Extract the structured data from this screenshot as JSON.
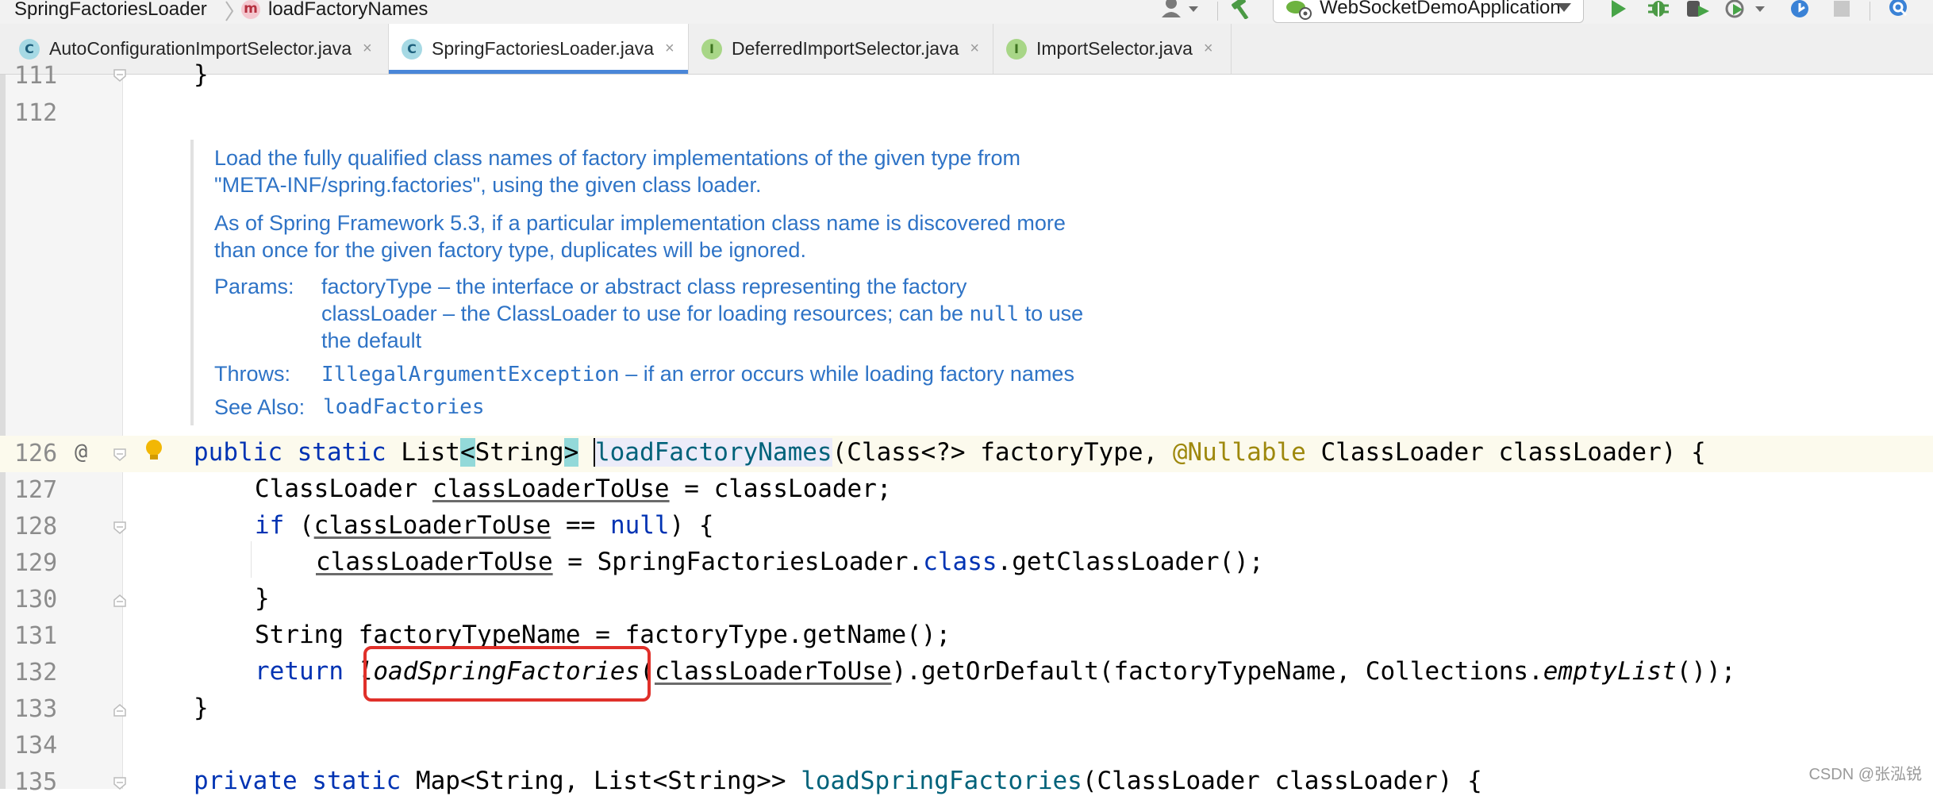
{
  "navbar": {
    "breadcrumb_class": "SpringFactoriesLoader",
    "breadcrumb_method_icon": "m",
    "breadcrumb_method": "loadFactoryNames",
    "run_config": "WebSocketDemoApplication"
  },
  "tabs": [
    {
      "label": "AutoConfigurationImportSelector.java",
      "icon": "C",
      "close": "×"
    },
    {
      "label": "SpringFactoriesLoader.java",
      "icon": "C",
      "close": "×"
    },
    {
      "label": "DeferredImportSelector.java",
      "icon": "I",
      "close": "×"
    },
    {
      "label": "ImportSelector.java",
      "icon": "I",
      "close": "×"
    }
  ],
  "gutter": {
    "line_numbers": [
      "111",
      "112",
      "126",
      "127",
      "128",
      "129",
      "130",
      "131",
      "132",
      "133",
      "134",
      "135"
    ],
    "at_marker": "@"
  },
  "doc": {
    "p1_line1": "Load the fully qualified class names of factory implementations of the given type from",
    "p1_line2": "\"META-INF/spring.factories\", using the given class loader.",
    "p2_line1": "As of Spring Framework 5.3, if a particular implementation class name is discovered more",
    "p2_line2": "than once for the given factory type, duplicates will be ignored.",
    "params_label": "Params:",
    "param1": "factoryType – the interface or abstract class representing the factory",
    "param2_a": "classLoader – the ClassLoader to use for loading resources; can be ",
    "param2_null": "null",
    "param2_b": " to use",
    "param2_line2": "the default",
    "throws_label": "Throws:",
    "throws_type": "IllegalArgumentException",
    "throws_text": " – if an error occurs while loading factory names",
    "see_label": "See Also:",
    "see_link": "loadFactories"
  },
  "code": {
    "l111": "}",
    "l126_a": "public static ",
    "l126_b": "List",
    "l126_c": "<",
    "l126_d": "String",
    "l126_e": ">",
    "l126_f": " ",
    "l126_method": "loadFactoryNames",
    "l126_g": "(Class<?> factoryType, ",
    "l126_ann": "@Nullable",
    "l126_h": " ClassLoader classLoader) {",
    "l127_a": "ClassLoader ",
    "l127_var": "classLoaderToUse",
    "l127_b": " = classLoader;",
    "l128_kw": "if",
    "l128_a": " (",
    "l128_var": "classLoaderToUse",
    "l128_b": " == ",
    "l128_null": "null",
    "l128_c": ") {",
    "l129_var": "classLoaderToUse",
    "l129_a": " = SpringFactoriesLoader.",
    "l129_kw": "class",
    "l129_b": ".getClassLoader();",
    "l130": "}",
    "l131": "String factoryTypeName = factoryType.getName();",
    "l132_kw": "return",
    "l132_sp": " ",
    "l132_call": "loadSpringFactories",
    "l132_a": "(",
    "l132_var": "classLoaderToUse",
    "l132_b": ").getOrDefault(factoryTypeName, Collections.",
    "l132_empty": "emptyList",
    "l132_c": "());",
    "l133": "}",
    "l135_a": "private static ",
    "l135_b": "Map<String, List<String>> ",
    "l135_method": "loadSpringFactories",
    "l135_c": "(ClassLoader classLoader) {"
  },
  "watermark": "CSDN @张泓锐",
  "colors": {
    "keyword": "#0033b3",
    "annotation": "#9e880d",
    "method_decl": "#00627a",
    "doc_text": "#2e73c6",
    "highlight_box": "#e0302a",
    "active_tab_underline": "#4a86d8"
  }
}
